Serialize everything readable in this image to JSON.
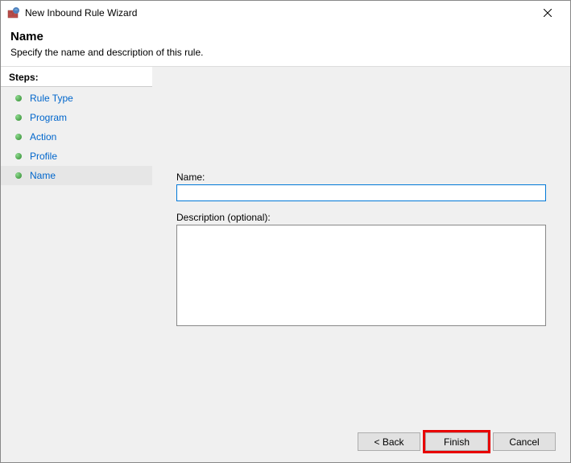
{
  "window": {
    "title": "New Inbound Rule Wizard"
  },
  "header": {
    "title": "Name",
    "subtitle": "Specify the name and description of this rule."
  },
  "sidebar": {
    "label": "Steps:",
    "items": [
      {
        "label": "Rule Type"
      },
      {
        "label": "Program"
      },
      {
        "label": "Action"
      },
      {
        "label": "Profile"
      },
      {
        "label": "Name"
      }
    ]
  },
  "form": {
    "name_label": "Name:",
    "name_value": "",
    "desc_label": "Description (optional):",
    "desc_value": ""
  },
  "buttons": {
    "back": "< Back",
    "finish": "Finish",
    "cancel": "Cancel"
  }
}
